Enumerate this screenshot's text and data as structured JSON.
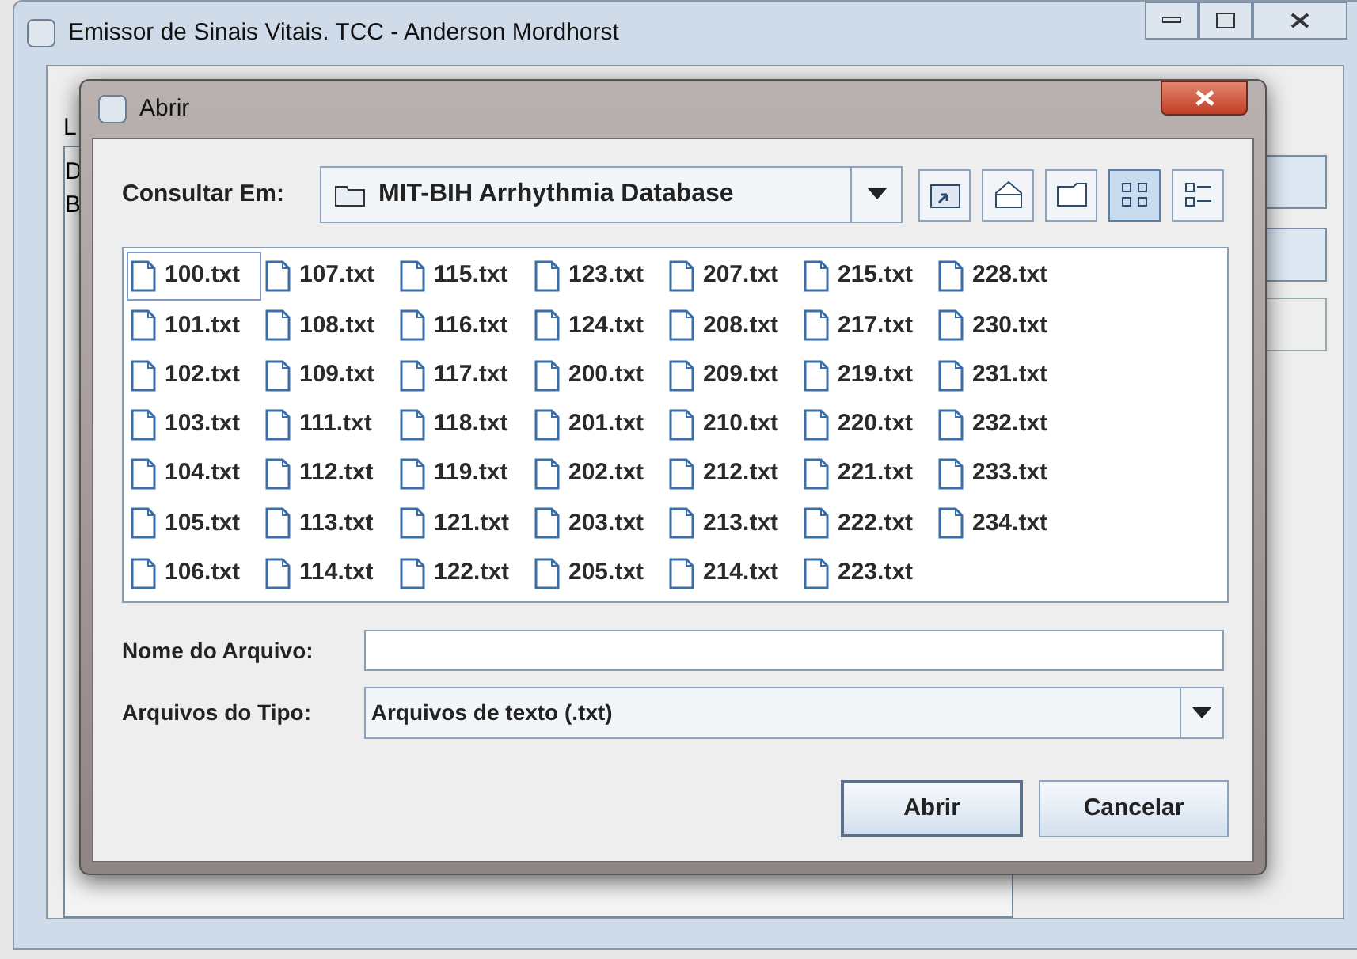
{
  "window": {
    "title": "Emissor de Sinais Vitais. TCC - Anderson Mordhorst"
  },
  "background_fragments": [
    "L",
    "D",
    "B"
  ],
  "dialog": {
    "title": "Abrir",
    "look_in": {
      "label": "Consultar Em:",
      "value": "MIT-BIH Arrhythmia Database"
    },
    "toolbar": [
      {
        "kind": "up",
        "selected": false
      },
      {
        "kind": "home",
        "selected": false
      },
      {
        "kind": "new-folder",
        "selected": false
      },
      {
        "kind": "list",
        "selected": true
      },
      {
        "kind": "details",
        "selected": false
      }
    ],
    "files": [
      {
        "name": "100.txt",
        "selected": true
      },
      {
        "name": "101.txt",
        "selected": false
      },
      {
        "name": "102.txt",
        "selected": false
      },
      {
        "name": "103.txt",
        "selected": false
      },
      {
        "name": "104.txt",
        "selected": false
      },
      {
        "name": "105.txt",
        "selected": false
      },
      {
        "name": "106.txt",
        "selected": false
      },
      {
        "name": "107.txt",
        "selected": false
      },
      {
        "name": "108.txt",
        "selected": false
      },
      {
        "name": "109.txt",
        "selected": false
      },
      {
        "name": "111.txt",
        "selected": false
      },
      {
        "name": "112.txt",
        "selected": false
      },
      {
        "name": "113.txt",
        "selected": false
      },
      {
        "name": "114.txt",
        "selected": false
      },
      {
        "name": "115.txt",
        "selected": false
      },
      {
        "name": "116.txt",
        "selected": false
      },
      {
        "name": "117.txt",
        "selected": false
      },
      {
        "name": "118.txt",
        "selected": false
      },
      {
        "name": "119.txt",
        "selected": false
      },
      {
        "name": "121.txt",
        "selected": false
      },
      {
        "name": "122.txt",
        "selected": false
      },
      {
        "name": "123.txt",
        "selected": false
      },
      {
        "name": "124.txt",
        "selected": false
      },
      {
        "name": "200.txt",
        "selected": false
      },
      {
        "name": "201.txt",
        "selected": false
      },
      {
        "name": "202.txt",
        "selected": false
      },
      {
        "name": "203.txt",
        "selected": false
      },
      {
        "name": "205.txt",
        "selected": false
      },
      {
        "name": "207.txt",
        "selected": false
      },
      {
        "name": "208.txt",
        "selected": false
      },
      {
        "name": "209.txt",
        "selected": false
      },
      {
        "name": "210.txt",
        "selected": false
      },
      {
        "name": "212.txt",
        "selected": false
      },
      {
        "name": "213.txt",
        "selected": false
      },
      {
        "name": "214.txt",
        "selected": false
      },
      {
        "name": "215.txt",
        "selected": false
      },
      {
        "name": "217.txt",
        "selected": false
      },
      {
        "name": "219.txt",
        "selected": false
      },
      {
        "name": "220.txt",
        "selected": false
      },
      {
        "name": "221.txt",
        "selected": false
      },
      {
        "name": "222.txt",
        "selected": false
      },
      {
        "name": "223.txt",
        "selected": false
      },
      {
        "name": "228.txt",
        "selected": false
      },
      {
        "name": "230.txt",
        "selected": false
      },
      {
        "name": "231.txt",
        "selected": false
      },
      {
        "name": "232.txt",
        "selected": false
      },
      {
        "name": "233.txt",
        "selected": false
      },
      {
        "name": "234.txt",
        "selected": false
      }
    ],
    "file_name": {
      "label": "Nome do Arquivo:"
    },
    "file_type": {
      "label": "Arquivos do Tipo:",
      "value": "Arquivos de texto (.txt)"
    },
    "buttons": [
      "Abrir",
      "Cancelar"
    ]
  }
}
